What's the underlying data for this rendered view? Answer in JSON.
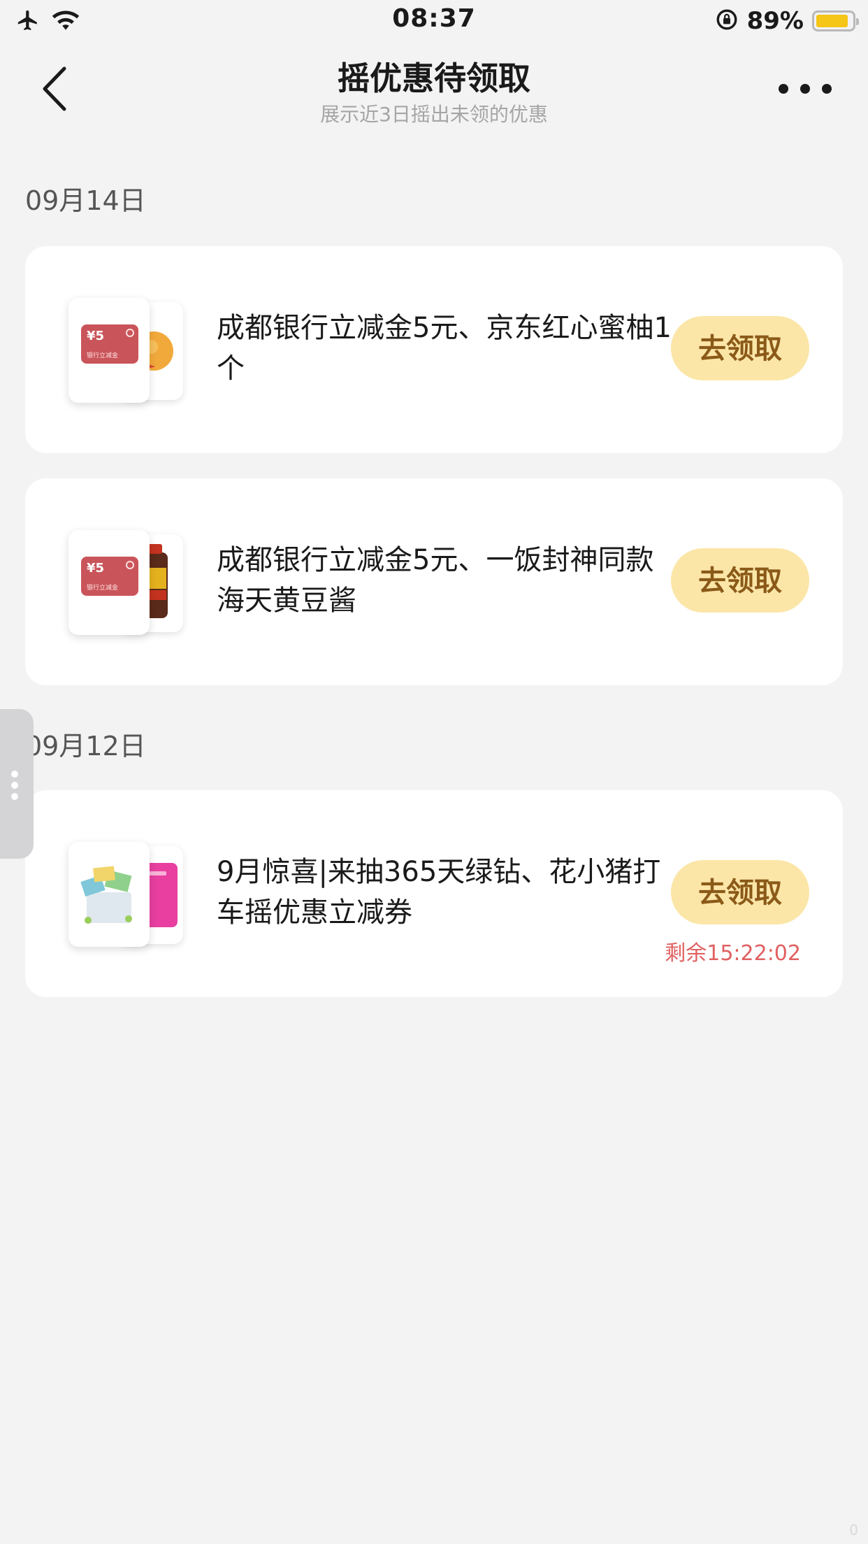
{
  "status_bar": {
    "time": "08:37",
    "battery_percent": "89%",
    "battery_level": 0.89,
    "icons": [
      "airplane-icon",
      "wifi-icon",
      "orientation-lock-icon",
      "battery-icon"
    ]
  },
  "nav": {
    "title": "摇优惠待领取",
    "subtitle": "展示近3日摇出未领的优惠"
  },
  "groups": [
    {
      "date": "09月14日",
      "items": [
        {
          "title": "成都银行立减金5元、京东红心蜜柚1个",
          "button": "去领取",
          "countdown": ""
        },
        {
          "title": "成都银行立减金5元、一饭封神同款海天黄豆酱",
          "button": "去领取",
          "countdown": ""
        }
      ]
    },
    {
      "date": "09月12日",
      "items": [
        {
          "title": "9月惊喜|来抽365天绿钻、花小猪打车摇优惠立减券",
          "button": "去领取",
          "countdown": "剩余15:22:02"
        }
      ]
    }
  ],
  "thumb_text": {
    "yen_label": "¥5",
    "card_label": "银行立减金"
  },
  "colors": {
    "background": "#f3f3f4",
    "button_bg": "#fbe6a8",
    "button_text": "#8b5a18",
    "countdown": "#e06060",
    "battery": "#f5c518"
  }
}
